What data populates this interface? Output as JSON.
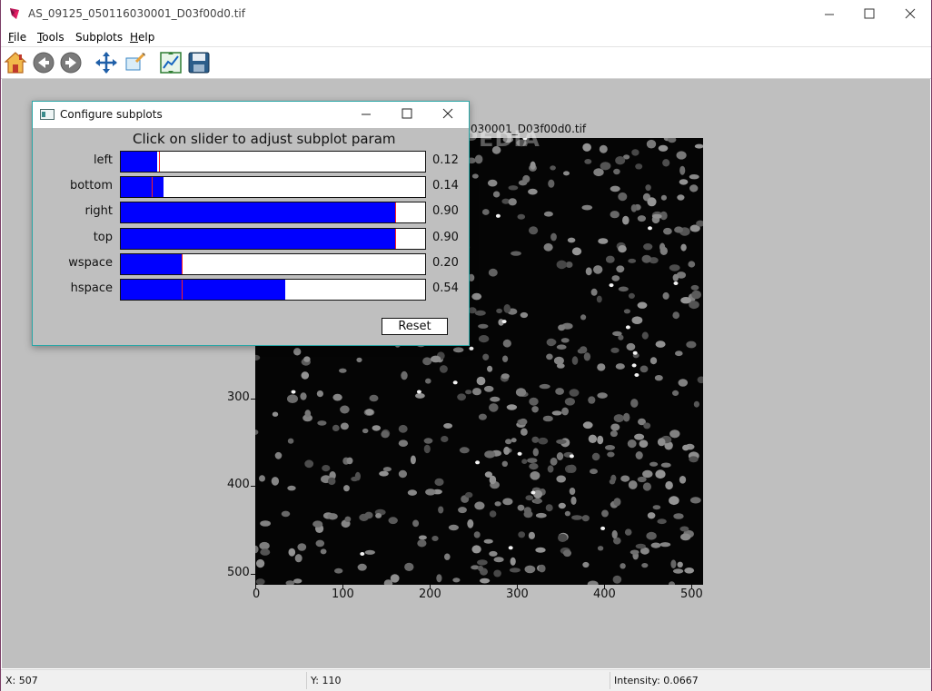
{
  "window": {
    "title": "AS_09125_050116030001_D03f00d0.tif",
    "controls": {
      "minimize": "minimize-icon",
      "maximize": "maximize-icon",
      "close": "close-icon"
    }
  },
  "menu": {
    "items": [
      {
        "label": "File",
        "accel": "F",
        "rest": "ile"
      },
      {
        "label": "Tools",
        "accel": "T",
        "rest": "ools"
      },
      {
        "label": "Subplots",
        "accel": "",
        "rest": "Subplots"
      },
      {
        "label": "Help",
        "accel": "H",
        "rest": "elp"
      }
    ]
  },
  "toolbar": {
    "buttons": [
      "home-icon",
      "back-icon",
      "forward-icon",
      "pan-icon",
      "zoom-icon",
      "configure-subplots-icon",
      "save-icon"
    ]
  },
  "figure": {
    "title_visible": "030001_D03f00d0.tif",
    "watermark": "SOFTPEDIA",
    "x_ticks": [
      "0",
      "100",
      "200",
      "300",
      "400",
      "500"
    ],
    "y_ticks": [
      "300",
      "400",
      "500"
    ]
  },
  "status": {
    "x": "X: 507",
    "y": "Y: 110",
    "intensity": "Intensity: 0.0667"
  },
  "dialog": {
    "title": "Configure subplots",
    "heading": "Click on slider to adjust subplot param",
    "reset_label": "Reset",
    "sliders": [
      {
        "label": "left",
        "value": 0.12,
        "value_text": "0.12",
        "initial": 0.125
      },
      {
        "label": "bottom",
        "value": 0.14,
        "value_text": "0.14",
        "initial": 0.1
      },
      {
        "label": "right",
        "value": 0.9,
        "value_text": "0.90",
        "initial": 0.9
      },
      {
        "label": "top",
        "value": 0.9,
        "value_text": "0.90",
        "initial": 0.9
      },
      {
        "label": "wspace",
        "value": 0.2,
        "value_text": "0.20",
        "initial": 0.2
      },
      {
        "label": "hspace",
        "value": 0.54,
        "value_text": "0.54",
        "initial": 0.2
      }
    ]
  },
  "colors": {
    "slider_fill": "#0000ff",
    "slider_initial": "#ff2020",
    "canvas_bg": "#bfbfbf"
  }
}
